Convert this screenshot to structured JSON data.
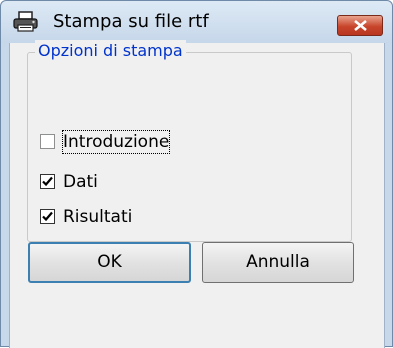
{
  "window": {
    "title": "Stampa su file rtf",
    "icon": "printer-icon",
    "close_icon": "close-icon"
  },
  "group": {
    "label": "Opzioni di stampa",
    "options": [
      {
        "label": "Introduzione",
        "checked": false
      },
      {
        "label": "Dati",
        "checked": true
      },
      {
        "label": "Risultati",
        "checked": true
      }
    ]
  },
  "buttons": {
    "ok": "OK",
    "cancel": "Annulla"
  },
  "colors": {
    "legend_text": "#0033cc",
    "close_button": "#c8452c",
    "titlebar": "#c7d8ea"
  }
}
